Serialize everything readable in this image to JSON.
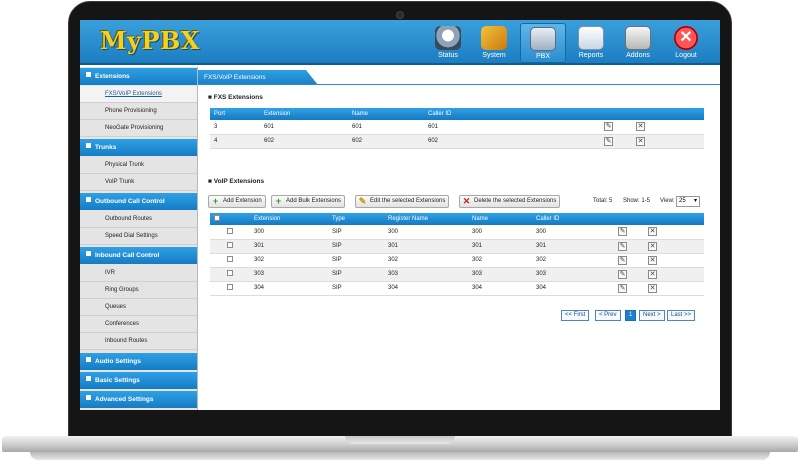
{
  "app": {
    "logo": "MyPBX"
  },
  "nav": [
    {
      "label": "Status",
      "icon": "status-icon"
    },
    {
      "label": "System",
      "icon": "system-icon"
    },
    {
      "label": "PBX",
      "icon": "pbx-icon"
    },
    {
      "label": "Reports",
      "icon": "reports-icon"
    },
    {
      "label": "Addons",
      "icon": "addons-icon"
    },
    {
      "label": "Logout",
      "icon": "logout-icon"
    }
  ],
  "sidebar": {
    "sections": [
      {
        "label": "Extensions",
        "items": [
          "FXS/VoIP Extensions",
          "Phone Provisioning",
          "NeoGate Provisioning"
        ]
      },
      {
        "label": "Trunks",
        "items": [
          "Physical Trunk",
          "VoIP Trunk"
        ]
      },
      {
        "label": "Outbound Call Control",
        "items": [
          "Outbound Routes",
          "Speed Dial Settings"
        ]
      },
      {
        "label": "Inbound Call Control",
        "items": [
          "IVR",
          "Ring Groups",
          "Queues",
          "Conferences",
          "Inbound Routes"
        ]
      },
      {
        "label": "Audio Settings",
        "items": []
      },
      {
        "label": "Basic Settings",
        "items": []
      },
      {
        "label": "Advanced Settings",
        "items": []
      }
    ]
  },
  "content": {
    "tab_title": "FXS/VoIP Extensions",
    "fxs": {
      "heading": "FXS Extensions",
      "columns": [
        "Port",
        "Extension",
        "Name",
        "Caller ID"
      ],
      "rows": [
        [
          "3",
          "601",
          "601",
          "601"
        ],
        [
          "4",
          "602",
          "602",
          "602"
        ]
      ]
    },
    "voip": {
      "heading": "VoIP Extensions",
      "toolbar": {
        "add": "Add Extension",
        "bulk": "Add Bulk Extensions",
        "edit": "Edit the selected Extensions",
        "delete": "Delete the selected Extensions"
      },
      "total": "Total: 5",
      "show": "Show: 1-5",
      "view_label": "View:",
      "view_value": "25",
      "columns": [
        "Extension",
        "Type",
        "Register Name",
        "Name",
        "Caller ID"
      ],
      "rows": [
        [
          "300",
          "SIP",
          "300",
          "300",
          "300"
        ],
        [
          "301",
          "SIP",
          "301",
          "301",
          "301"
        ],
        [
          "302",
          "SIP",
          "302",
          "302",
          "302"
        ],
        [
          "303",
          "SIP",
          "303",
          "303",
          "303"
        ],
        [
          "304",
          "SIP",
          "304",
          "304",
          "304"
        ]
      ]
    },
    "pagination": {
      "first": "<< First",
      "prev": "< Prev",
      "current": "1",
      "next": "Next >",
      "last": "Last >>"
    }
  }
}
